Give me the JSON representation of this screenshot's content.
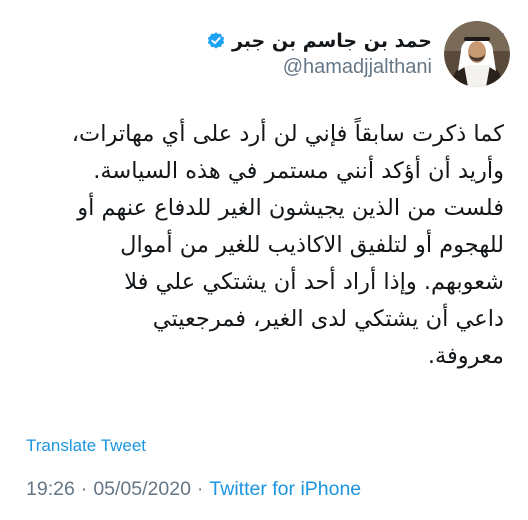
{
  "tweet": {
    "display_name": "حمد بن جاسم بن جبر",
    "handle": "@hamadjjalthani",
    "verified_icon": "verified-badge-icon",
    "body": "كما ذكرت سابقاً  فإني لن أرد على أي مهاترات،\nوأريد أن أؤكد أنني مستمر في هذه السياسة.\nفلست من الذين يجيشون الغير للدفاع عنهم أو\nللهجوم أو لتلفيق الاكاذيب للغير من أموال\nشعوبهم. وإذا أراد أحد أن يشتكي علي فلا\nداعي أن يشتكي لدى الغير، فمرجعيتي\nمعروفة.",
    "translate_label": "Translate Tweet",
    "time": "19:26",
    "separator": "·",
    "date": "05/05/2020",
    "source": "Twitter for iPhone"
  },
  "colors": {
    "link": "#1b95e0",
    "secondary": "#657786",
    "text": "#14171a"
  }
}
